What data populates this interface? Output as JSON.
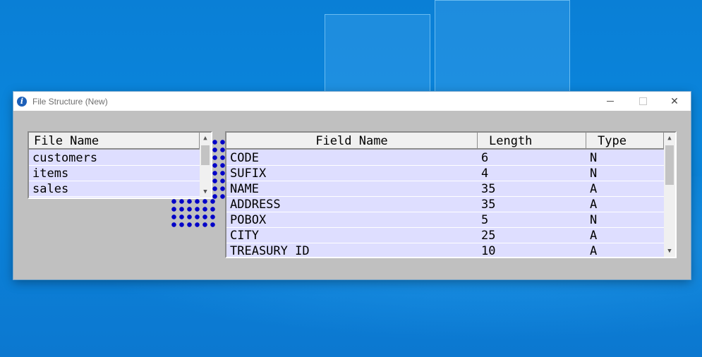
{
  "window": {
    "title": "File Structure (New)",
    "title_icon": "info-icon",
    "controls": {
      "minimize": "minimize-icon",
      "maximize": "maximize-icon",
      "close_glyph": "✕"
    }
  },
  "files_table": {
    "header": "File Name",
    "items": [
      "customers",
      "items",
      "sales"
    ],
    "scroll_up": "▲",
    "scroll_down": "▼"
  },
  "fields_table": {
    "columns": [
      "Field Name",
      "Length",
      "Type"
    ],
    "rows": [
      {
        "name": "CODE",
        "length": "6",
        "type": "N"
      },
      {
        "name": "SUFIX",
        "length": "4",
        "type": "N"
      },
      {
        "name": "NAME",
        "length": "35",
        "type": "A"
      },
      {
        "name": "ADDRESS",
        "length": "35",
        "type": "A"
      },
      {
        "name": "POBOX",
        "length": "5",
        "type": "N"
      },
      {
        "name": "CITY",
        "length": "25",
        "type": "A"
      },
      {
        "name": "TREASURY_ID",
        "length": "10",
        "type": "A"
      }
    ],
    "scroll_up": "▲",
    "scroll_down": "▼"
  },
  "colors": {
    "window_bg": "#c0c0c0",
    "grid_bg": "#dedeff",
    "header_bg": "#f0f0f0",
    "drag_dots": "#0000c8",
    "desktop": "#0a7fd6"
  }
}
